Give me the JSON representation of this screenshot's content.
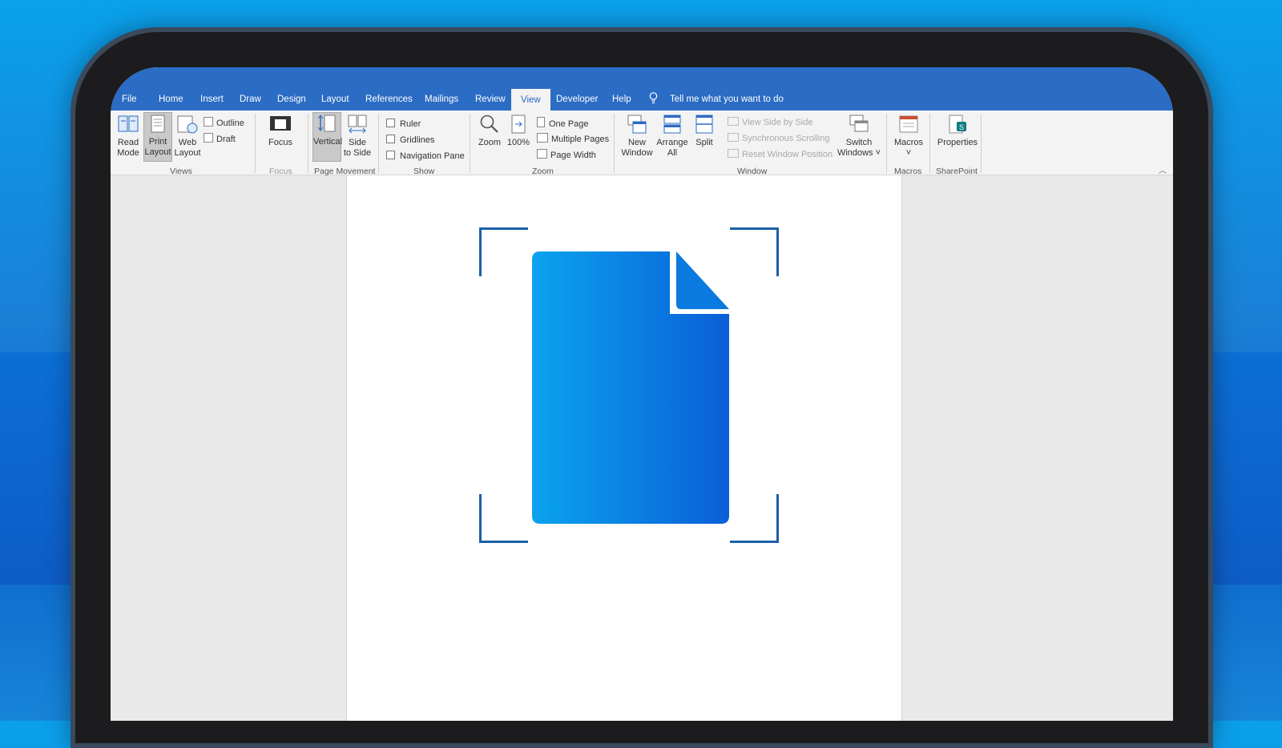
{
  "tabs": [
    {
      "label": "File"
    },
    {
      "label": "Home"
    },
    {
      "label": "Insert"
    },
    {
      "label": "Draw"
    },
    {
      "label": "Design"
    },
    {
      "label": "Layout"
    },
    {
      "label": "References"
    },
    {
      "label": "Mailings"
    },
    {
      "label": "Review"
    },
    {
      "label": "View"
    },
    {
      "label": "Developer"
    },
    {
      "label": "Help"
    }
  ],
  "tell_me": "Tell me what you want to do",
  "views": {
    "read_mode": [
      "Read",
      "Mode"
    ],
    "print_layout": [
      "Print",
      "Layout"
    ],
    "web_layout": [
      "Web",
      "Layout"
    ],
    "outline": "Outline",
    "draft": "Draft",
    "group": "Views"
  },
  "focus": {
    "label": "Focus",
    "group": "Focus"
  },
  "page_movement": {
    "vertical": "Vertical",
    "side_to_side": [
      "Side",
      "to Side"
    ],
    "group": "Page Movement"
  },
  "show": {
    "ruler": "Ruler",
    "gridlines": "Gridlines",
    "navigation_pane": "Navigation Pane",
    "group": "Show"
  },
  "zoom": {
    "zoom": "Zoom",
    "hundred": "100%",
    "one_page": "One Page",
    "multiple_pages": "Multiple Pages",
    "page_width": "Page Width",
    "group": "Zoom"
  },
  "window": {
    "new_window": [
      "New",
      "Window"
    ],
    "arrange_all": [
      "Arrange",
      "All"
    ],
    "split": "Split",
    "view_side_by_side": "View Side by Side",
    "synchronous_scrolling": "Synchronous Scrolling",
    "reset_window_position": "Reset Window Position",
    "switch_windows": [
      "Switch",
      "Windows ˅"
    ],
    "group": "Window"
  },
  "macros": {
    "label": "Macros",
    "arrow": "˅",
    "group": "Macros"
  },
  "sharepoint": {
    "label": "Properties",
    "group": "SharePoint"
  },
  "colors": {
    "accent": "#2b6cc4",
    "doc_icon_from": "#0aa3ee",
    "doc_icon_to": "#0a5fd8",
    "bracket": "#1b5fa8"
  }
}
